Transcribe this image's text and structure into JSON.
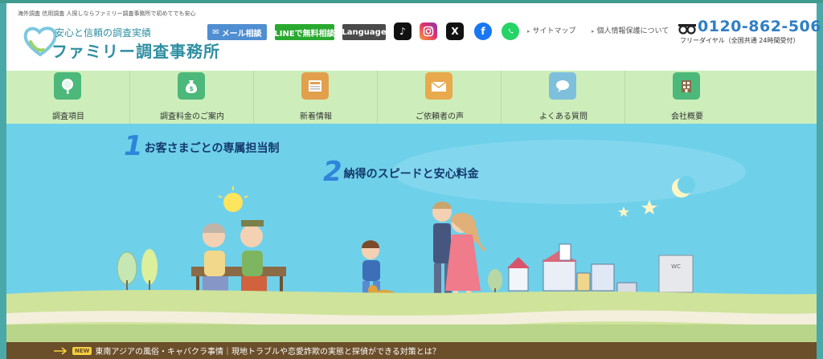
{
  "header": {
    "tagline": "海外調査 信用調査 人探しならファミリー調査事務所で初めてでも安心",
    "logo_sub": "安心と信頼の調査実績",
    "logo_main": "ファミリー調査事務所",
    "mail_button": "メール相談",
    "line_button": "LINEで無料相談",
    "language_button": "Language",
    "sitemap_link": "サイトマップ",
    "privacy_link": "個人情報保護について",
    "phone_number": "0120-862-506",
    "phone_note": "フリーダイヤル（全国共通 24時間受付）"
  },
  "sns": [
    "tiktok-icon",
    "instagram-icon",
    "x-icon",
    "facebook-icon",
    "whatsapp-icon"
  ],
  "nav": {
    "items": [
      {
        "label": "調査項目",
        "icon": "magnifier-icon",
        "color": "#4cb87a"
      },
      {
        "label": "調査料金のご案内",
        "icon": "money-bag-icon",
        "color": "#4cb87a"
      },
      {
        "label": "新着情報",
        "icon": "newspaper-icon",
        "color": "#e2a04d"
      },
      {
        "label": "ご依頼者の声",
        "icon": "envelope-icon",
        "color": "#e9a94d"
      },
      {
        "label": "よくある質問",
        "icon": "speech-bubble-icon",
        "color": "#7ec0dc"
      },
      {
        "label": "会社概要",
        "icon": "building-icon",
        "color": "#4cb87a"
      }
    ]
  },
  "hero": {
    "slogan1_num": "1",
    "slogan1_text": "お客さまごとの専属担当制",
    "slogan2_num": "2",
    "slogan2_text": "納得のスピードと安心料金",
    "toilet_sign": "WC"
  },
  "news": {
    "badge": "NEW",
    "text": "東南アジアの風俗・キャバクラ事情｜現地トラブルや恋愛詐欺の実態と探偵ができる対策とは？"
  },
  "colors": {
    "brand": "#2f8fa1",
    "phone": "#2f7fc4",
    "nav_bg": "#cdeebb",
    "sky": "#6fd0ea",
    "news_bg": "#6b4e2a"
  }
}
